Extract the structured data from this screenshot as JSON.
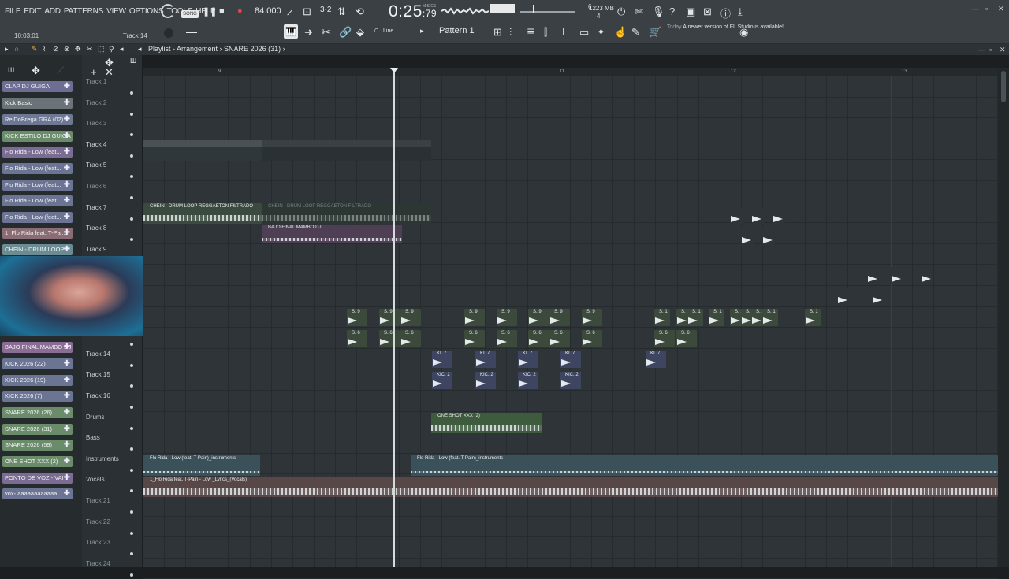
{
  "menu": [
    "FILE",
    "EDIT",
    "ADD",
    "PATTERNS",
    "VIEW",
    "OPTIONS",
    "TOOLS",
    "HELP"
  ],
  "transport": {
    "mode": "SONG",
    "tempo": "84.000",
    "time_main": "0:25",
    "time_frac": "79",
    "time_unit": "M:S:CS"
  },
  "memory": {
    "mb": "1223 MB",
    "cpu": "6",
    "poly": "4"
  },
  "status": {
    "clock": "10:03:01",
    "hint": "Track 14"
  },
  "snap": "Line",
  "pattern": "Pattern 1",
  "news": {
    "date": "Today",
    "text": "A newer version of FL Studio is available!"
  },
  "playlist": {
    "title": "Playlist - Arrangement",
    "clip": "SNARE 2026 (31)"
  },
  "ruler": [
    "9",
    "11",
    "12",
    "13"
  ],
  "picker": [
    {
      "label": "CLAP DJ GUIGA",
      "color": "#6e6e94"
    },
    {
      "label": "Kick Basic",
      "color": "#6c7378"
    },
    {
      "label": "ReiDoBrega GRA (02)",
      "color": "#6e7894"
    },
    {
      "label": "KICK ESTILO DJ GUIGA",
      "color": "#6a8c6a"
    },
    {
      "label": "Flo Rida - Low (feat...",
      "color": "#7b6c94"
    },
    {
      "label": "Flo Rida - Low (feat...",
      "color": "#6c7494"
    },
    {
      "label": "Flo Rida - Low (feat...",
      "color": "#6c7494"
    },
    {
      "label": "Flo Rida - Low (feat...",
      "color": "#6c7494"
    },
    {
      "label": "Flo Rida - Low (feat...",
      "color": "#6c7494"
    },
    {
      "label": "1_Flo Rida feat. T-Pai...",
      "color": "#8a6c74"
    },
    {
      "label": "CHEIN - DRUM LOOP...",
      "color": "#6c8c94"
    },
    {
      "label": "BAJO FINAL MAMBO DJ",
      "color": "#8a6c94"
    },
    {
      "label": "KICK 2026 (22)",
      "color": "#6c7494"
    },
    {
      "label": "KICK 2026 (19)",
      "color": "#6c7494"
    },
    {
      "label": "KICK 2026 (7)",
      "color": "#6c7494"
    },
    {
      "label": "SNARE 2026 (26)",
      "color": "#6a8c6a"
    },
    {
      "label": "SNARE 2026 (31)",
      "color": "#6a8c6a"
    },
    {
      "label": "SNARE 2026 (59)",
      "color": "#6a8c6a"
    },
    {
      "label": "ONE SHOT XXX (2)",
      "color": "#6a8c6a"
    },
    {
      "label": "PONTO DE VOZ - VAI",
      "color": "#7b6c94"
    },
    {
      "label": "vox- aaaaaaaaaaaa...",
      "color": "#6c7494"
    }
  ],
  "tracks": [
    "Track 1",
    "Track 2",
    "Track 3",
    "Track 4",
    "Track 5",
    "Track 6",
    "Track 7",
    "Track 8",
    "Track 9",
    "",
    "",
    "",
    "",
    "Track 14",
    "Track 15",
    "Track 16",
    "Drums",
    "Bass",
    "Instruments",
    "Vocals",
    "Track 21",
    "Track 22",
    "Track 23",
    "Track 24"
  ],
  "clips": {
    "pattern1": "Pattern 1",
    "pattern1b": "Pattern 1",
    "chein": "CHEIN - DRUM LOOP REGGAETON FILTRADO",
    "chein2": "CHEIN - DRUM LOOP REGGAETON FILTRADO",
    "bajo": "BAJO FINAL MAMBO DJ",
    "oneshot": "ONE SHOT XXX (2)",
    "instr1": "Flo Rida - Low (feat. T-Pain)_instruments",
    "instr2": "Flo Rida - Low (feat. T-Pain)_instruments",
    "vocals": "1_Flo Rida feat. T-Pain - Low _Lyrics_(Vocals)",
    "s9": "S. 9",
    "s6": "S. 6",
    "s1": "S. 1",
    "ki7": "KI. 7",
    "kic2": "KIC. 2"
  }
}
